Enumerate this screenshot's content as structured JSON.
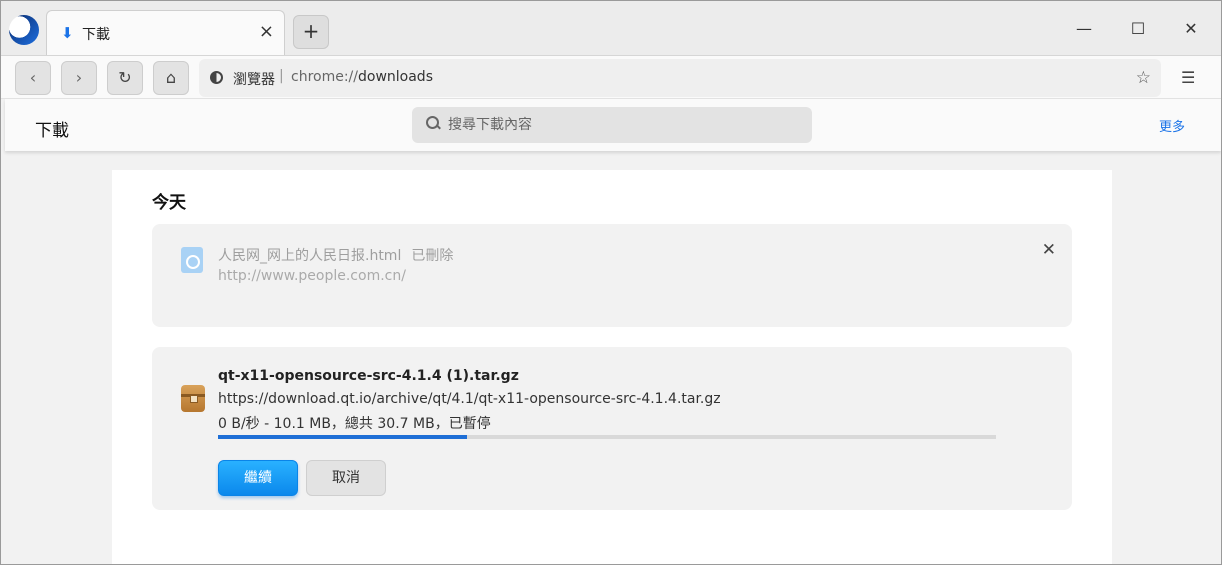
{
  "tab": {
    "title": "下載",
    "icon": "download-icon",
    "close": "×"
  },
  "new_tab": "+",
  "window_controls": {
    "minimize": "—",
    "maximize": "☐",
    "close": "✕"
  },
  "toolbar": {
    "back": "‹",
    "forward": "›",
    "reload": "↻",
    "home": "⌂",
    "site_label": "瀏覽器",
    "separator": "|",
    "url_scheme": "chrome://",
    "url_path": "downloads",
    "bookmark": "☆",
    "menu": "☰"
  },
  "header": {
    "title": "下載",
    "search_placeholder": "搜尋下載內容",
    "more": "更多"
  },
  "section": {
    "date": "今天"
  },
  "items": [
    {
      "name": "人民网_网上的人民日报.html",
      "status_tag": "已刪除",
      "url": "http://www.people.com.cn/",
      "remove": "✕"
    },
    {
      "name": "qt-x11-opensource-src-4.1.4 (1).tar.gz",
      "url": "https://download.qt.io/archive/qt/4.1/qt-x11-opensource-src-4.1.4.tar.gz",
      "status": "0 B/秒 - 10.1 MB，總共 30.7 MB，已暫停",
      "progress": 0.32,
      "resume_label": "繼續",
      "cancel_label": "取消"
    }
  ],
  "colors": {
    "accent": "#1a73e8",
    "progress": "#1f6fd6",
    "resume_button": "#0b88ec"
  }
}
